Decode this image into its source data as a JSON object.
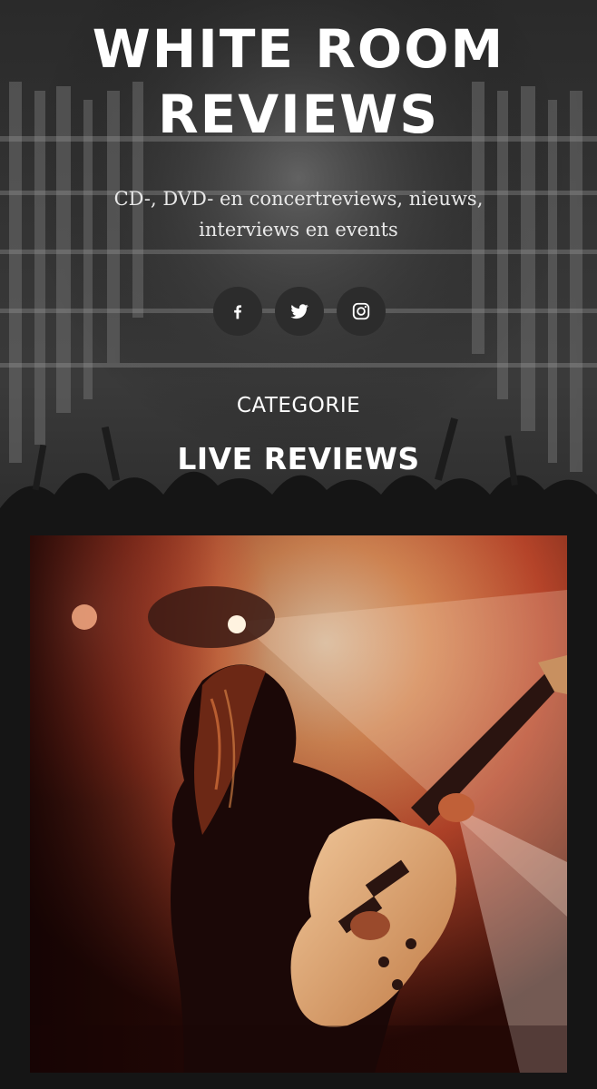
{
  "site": {
    "title": "WHITE ROOM REVIEWS",
    "tagline": "CD-, DVD- en concertreviews, nieuws, interviews en events"
  },
  "social": [
    {
      "name": "facebook",
      "icon": "facebook-icon"
    },
    {
      "name": "twitter",
      "icon": "twitter-icon"
    },
    {
      "name": "instagram",
      "icon": "instagram-icon"
    }
  ],
  "archive": {
    "label": "CATEGORIE",
    "name": "LIVE REVIEWS"
  },
  "featured_post": {
    "image": "guitarist-on-stage-photo"
  },
  "colors": {
    "background": "#1a1a1a",
    "text": "#ffffff",
    "social_button": "#2c2c2c"
  }
}
